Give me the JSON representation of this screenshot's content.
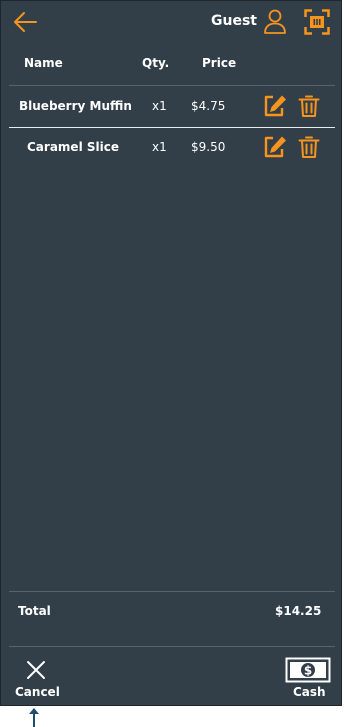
{
  "header": {
    "guest_label": "Guest",
    "back_icon": "arrow-left-icon",
    "user_icon": "user-icon",
    "scan_icon": "scan-icon"
  },
  "columns": {
    "name": "Name",
    "qty": "Qty.",
    "price": "Price"
  },
  "items": [
    {
      "name": "Blueberry Muffin",
      "qty": "x1",
      "price": "$4.75"
    },
    {
      "name": "Caramel Slice",
      "qty": "x1",
      "price": "$9.50"
    }
  ],
  "footer": {
    "total_label": "Total",
    "total_value": "$14.25",
    "cancel_label": "Cancel",
    "cash_label": "Cash"
  },
  "colors": {
    "background": "#323f48",
    "accent": "#f7941d",
    "text": "#ffffff",
    "pointer": "#1e4d6b"
  }
}
